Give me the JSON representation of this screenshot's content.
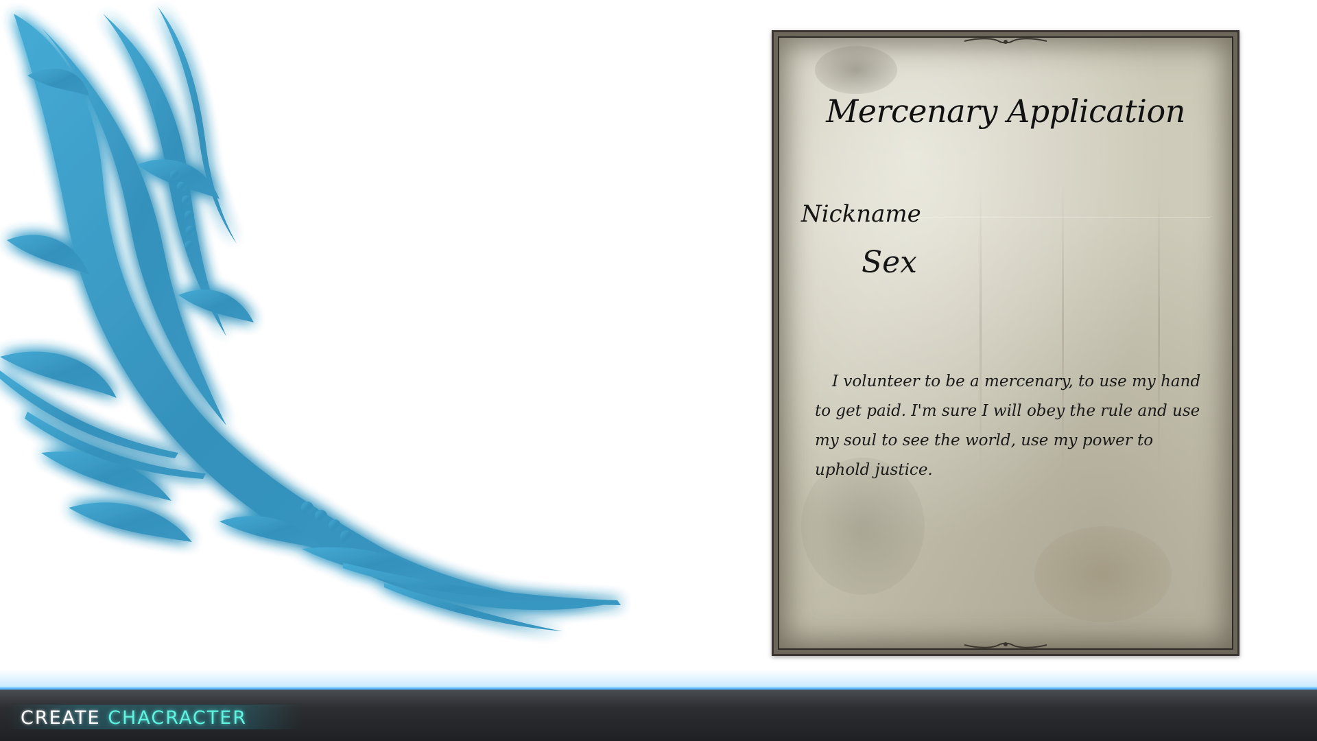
{
  "screen": {
    "title_part1": "CREATE",
    "title_part2": "CHACRACTER"
  },
  "application_form": {
    "title": "Mercenary Application",
    "nickname_label": "Nickname",
    "sex_label": "Sex",
    "oath": "I volunteer to be a mercenary,  to use my hand to get paid. I'm sure I will obey the rule and use my  soul to see the world, use my power to uphold justice."
  },
  "theme": {
    "ornament_color": "#3a9cc4",
    "ornament_glow": "#8fd6ff",
    "parchment_color": "#cfccba",
    "bar_color": "#2c2e31",
    "bar_accent": "#5bb8ff",
    "title_accent": "#5ff3e0"
  },
  "icons": {
    "ornament": "blue-floral-ornament",
    "frame_flourish": "parchment-flourish-icon"
  }
}
